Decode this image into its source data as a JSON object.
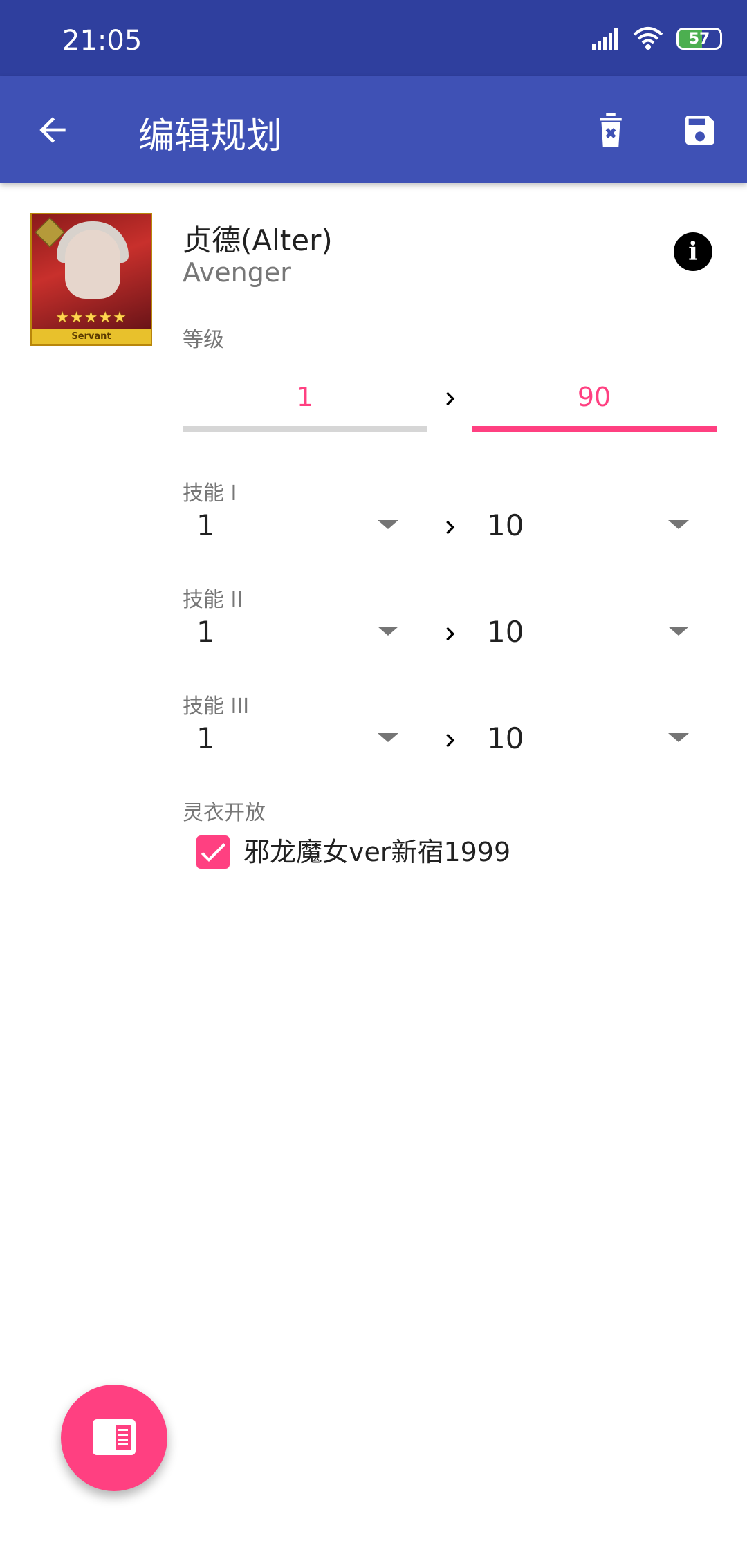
{
  "status_bar": {
    "time": "21:05",
    "battery_percent": "57",
    "icons": [
      "signal-icon",
      "wifi-icon",
      "battery-icon"
    ]
  },
  "app_bar": {
    "title": "编辑规划",
    "back_icon": "arrow-back-icon",
    "delete_icon": "delete-forever-icon",
    "save_icon": "save-icon"
  },
  "servant": {
    "name": "贞德(Alter)",
    "class": "Avenger",
    "card_stars": "★★★★★",
    "card_label": "Servant"
  },
  "level": {
    "label": "等级",
    "from": "1",
    "to": "90"
  },
  "skills": [
    {
      "label": "技能 I",
      "from": "1",
      "to": "10"
    },
    {
      "label": "技能 II",
      "from": "1",
      "to": "10"
    },
    {
      "label": "技能 III",
      "from": "1",
      "to": "10"
    }
  ],
  "costume": {
    "label": "灵衣开放",
    "item_label": "邪龙魔女ver新宿1999",
    "checked": true
  },
  "colors": {
    "primary": "#3f51b5",
    "primary_dark": "#2f3f9e",
    "accent": "#ff4081",
    "battery_fill": "#4caf50"
  }
}
